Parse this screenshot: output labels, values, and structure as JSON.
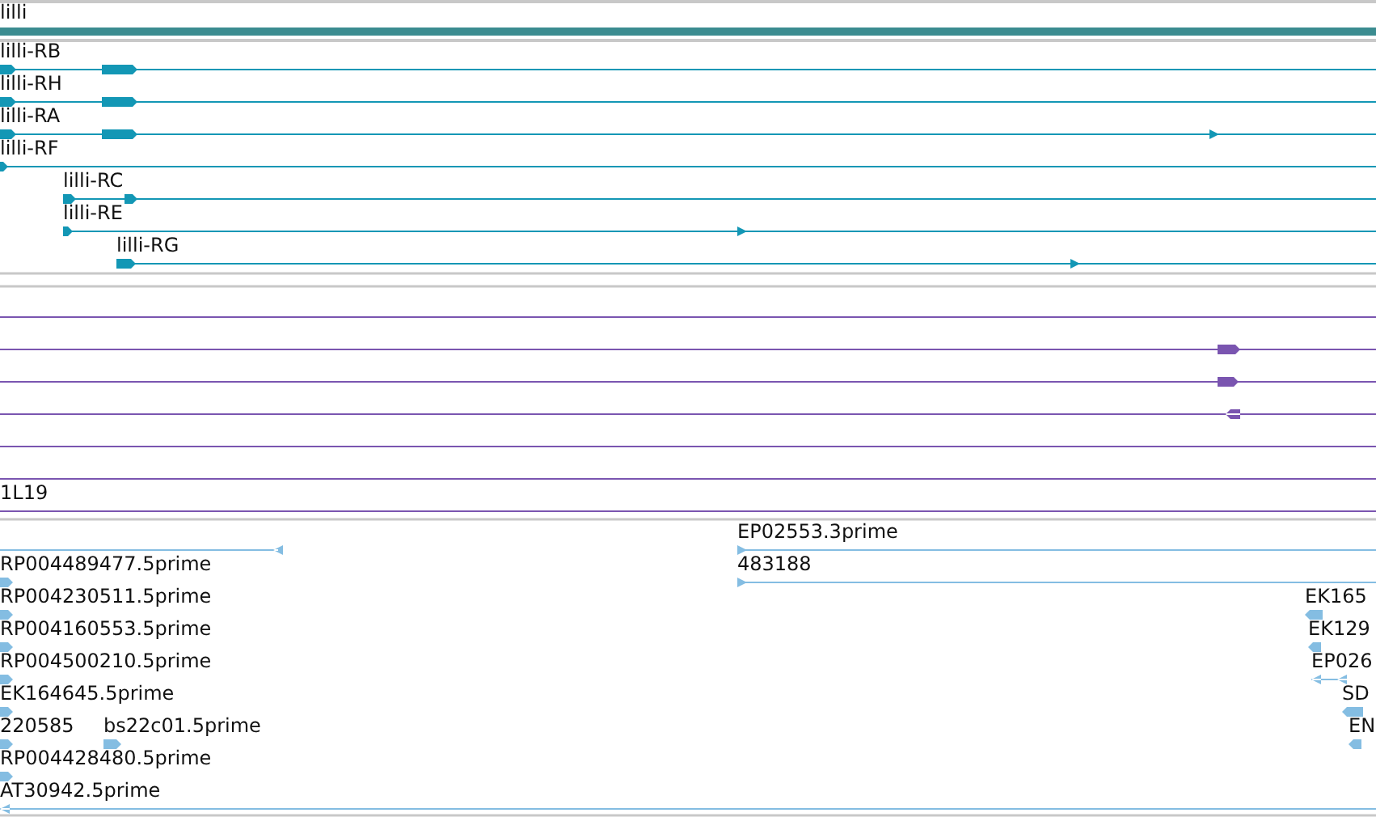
{
  "gene_track": {
    "label": "lilli"
  },
  "transcripts": [
    {
      "label": "lilli-RB",
      "reverse": false
    },
    {
      "label": "lilli-RH",
      "reverse": false
    },
    {
      "label": "lilli-RA",
      "reverse": false
    },
    {
      "label": "lilli-RF",
      "reverse": false
    },
    {
      "label": "lilli-RC",
      "reverse": false
    },
    {
      "label": "lilli-RE",
      "reverse": false
    },
    {
      "label": "lilli-RG",
      "reverse": false
    }
  ],
  "alignment_track": {
    "label": "1L19"
  },
  "est_track": {
    "left": [
      {
        "label": "RP004489477.5prime",
        "reverse": false
      },
      {
        "label": "RP004230511.5prime",
        "reverse": false
      },
      {
        "label": "RP004160553.5prime",
        "reverse": false
      },
      {
        "label": "RP004500210.5prime",
        "reverse": false
      },
      {
        "label": "EK164645.5prime",
        "reverse": false
      },
      {
        "label": "220585",
        "reverse": false
      },
      {
        "label": "bs22c01.5prime",
        "reverse": false
      },
      {
        "label": "RP004428480.5prime",
        "reverse": false
      },
      {
        "label": "AT30942.5prime",
        "reverse": true
      }
    ],
    "right": [
      {
        "label": "EP02553.3prime",
        "reverse": false
      },
      {
        "label": "483188",
        "reverse": false
      },
      {
        "label": "EK165",
        "reverse": true
      },
      {
        "label": "EK129",
        "reverse": true
      },
      {
        "label": "EP026",
        "reverse": true
      },
      {
        "label": "SD",
        "reverse": true
      },
      {
        "label": "EN",
        "reverse": true
      }
    ]
  }
}
